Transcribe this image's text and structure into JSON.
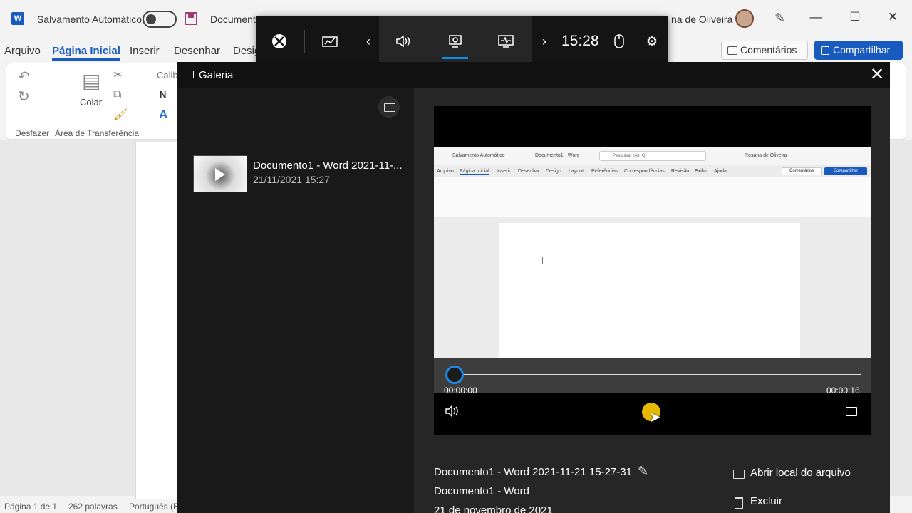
{
  "word": {
    "autosave_label": "Salvamento Automático",
    "doc_title": "Documento",
    "user_name": "na de Oliveira",
    "tabs": [
      "Arquivo",
      "Página Inicial",
      "Inserir",
      "Desenhar",
      "Desig"
    ],
    "comments_label": "Comentários",
    "share_label": "Compartilhar",
    "ribbon": {
      "paste_label": "Colar",
      "font_partial": "Calib",
      "undo_group": "Desfazer",
      "clipboard_group": "Área de Transferência"
    },
    "status": {
      "page": "Página 1 de 1",
      "words": "262 palavras",
      "language": "Português (B"
    }
  },
  "gamebar": {
    "clock": "15:28",
    "icons": [
      "xbox-icon",
      "performance-icon",
      "chevron-left-icon",
      "audio-icon",
      "capture-icon",
      "resources-icon",
      "chevron-right-icon",
      "mouse-icon",
      "gear-icon"
    ]
  },
  "gallery": {
    "title": "Galeria",
    "item": {
      "title": "Documento1 - Word 2021-11-...",
      "date": "21/11/2021 15:27"
    },
    "player": {
      "current_time": "00:00:00",
      "duration": "00:00:16",
      "progress": 0
    },
    "capture_preview": {
      "autosave": "Salvamento Automático",
      "doc_title": "Documento1 - Word",
      "search": "Pesquisar (Alt+Q)",
      "user": "Rosana de Oliveira",
      "tabs": [
        "Arquivo",
        "Página Inicial",
        "Inserir",
        "Desenhar",
        "Design",
        "Layout",
        "Referências",
        "Correspondências",
        "Revisão",
        "Exibir",
        "Ajuda"
      ],
      "comments": "Comentários",
      "share": "Compartilhar"
    },
    "details": {
      "filename": "Documento1 - Word 2021-11-21 15-27-31",
      "app": "Documento1 - Word",
      "date": "21 de novembro de 2021"
    },
    "actions": {
      "open_location": "Abrir local do arquivo",
      "delete": "Excluir"
    }
  },
  "colors": {
    "accent_blue": "#185abd",
    "gamebar_accent": "#0b8fe6",
    "play_button": "#e6b800"
  }
}
